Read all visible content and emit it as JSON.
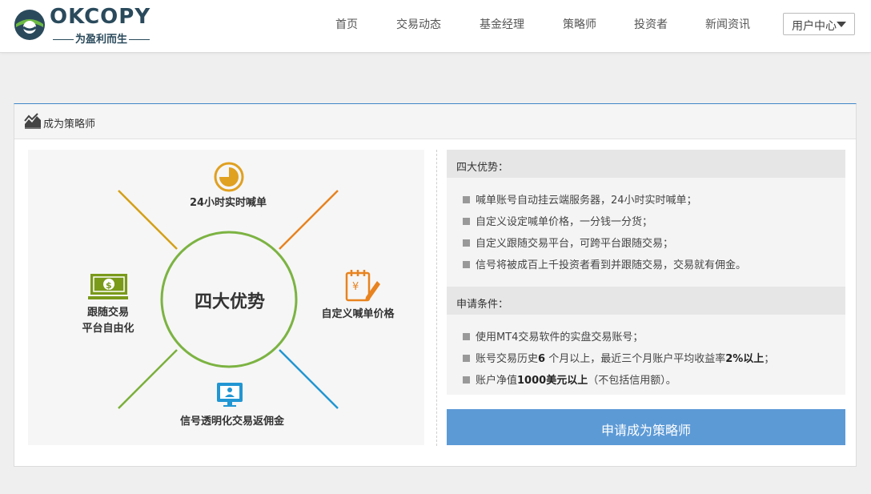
{
  "brand": {
    "name": "OKCOPY",
    "slogan": "为盈利而生"
  },
  "nav": {
    "items": [
      {
        "label": "首页"
      },
      {
        "label": "交易动态"
      },
      {
        "label": "基金经理"
      },
      {
        "label": "策略师"
      },
      {
        "label": "投资者"
      },
      {
        "label": "新闻资讯"
      }
    ],
    "user_center": "用户中心"
  },
  "panel": {
    "title": "成为策略师",
    "diagram": {
      "center": "四大优势",
      "top": "24小时实时喊单",
      "right": "自定义喊单价格",
      "bottom": "信号透明化交易返佣金",
      "left_line1": "跟随交易",
      "left_line2": "平台自由化"
    },
    "advantages": {
      "heading": "四大优势：",
      "items": [
        "喊单账号自动挂云端服务器，24小时实时喊单；",
        "自定义设定喊单价格，一分钱一分货；",
        "自定义跟随交易平台，可跨平台跟随交易；",
        "信号将被成百上千投资者看到并跟随交易，交易就有佣金。"
      ]
    },
    "conditions": {
      "heading": "申请条件：",
      "item1": "使用MT4交易软件的实盘交易账号；",
      "item2_a": "账号交易历史",
      "item2_b": "6",
      "item2_c": " 个月以上，最近三个月账户平均收益率",
      "item2_d": "2%以上",
      "item2_e": "；",
      "item3_a": "账户净值",
      "item3_b": "1000美元以上",
      "item3_c": "（不包括信用额）。"
    },
    "apply_button": "申请成为策略师"
  },
  "colors": {
    "accent_blue": "#5c9ad6",
    "circle_green": "#7cb342",
    "line_yellow": "#d4a017",
    "line_orange": "#e8831f",
    "line_blue": "#2196d3",
    "line_green": "#7ab03a"
  },
  "icons": {
    "logo": "okcopy-logo-icon",
    "panel": "trend-chart-icon",
    "top": "clock-icon",
    "right": "price-edit-icon",
    "bottom": "monitor-user-icon",
    "left": "money-bill-icon"
  }
}
